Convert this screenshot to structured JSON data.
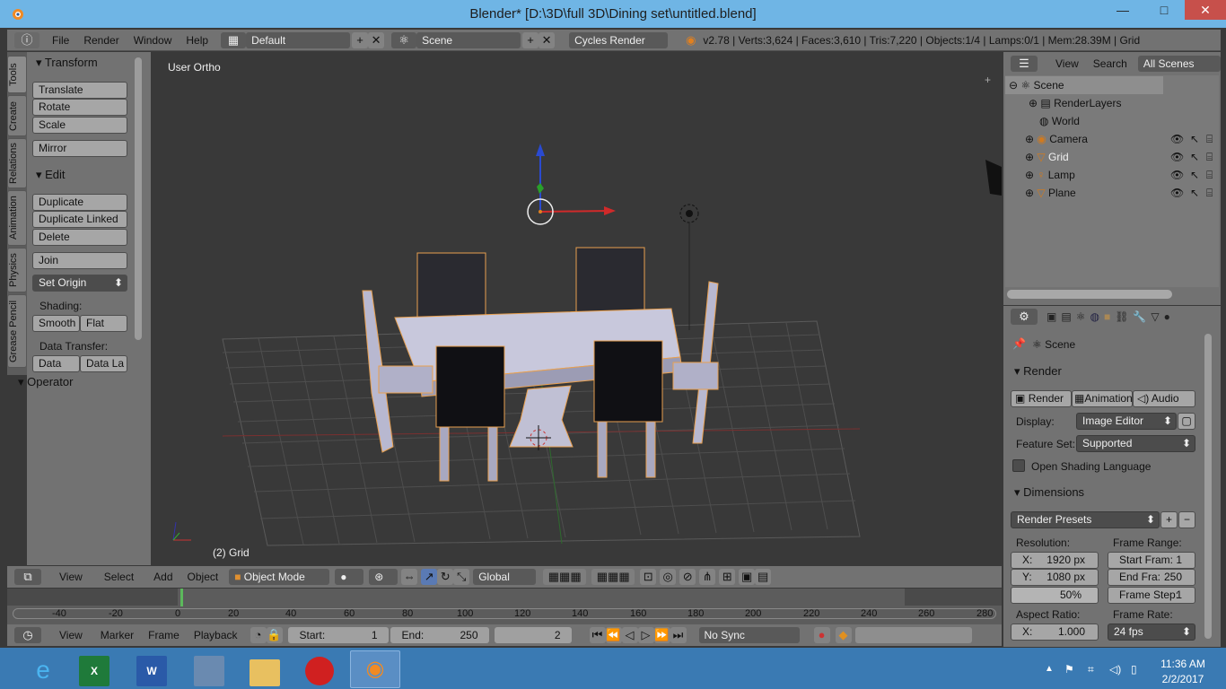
{
  "window": {
    "title": "Blender* [D:\\3D\\full 3D\\Dining set\\untitled.blend]",
    "minimize": "—",
    "maximize": "□",
    "close": "✕"
  },
  "info_header": {
    "menus": [
      "File",
      "Render",
      "Window",
      "Help"
    ],
    "layout": "Default",
    "scene": "Scene",
    "engine": "Cycles Render",
    "stats": "v2.78 | Verts:3,624 | Faces:3,610 | Tris:7,220 | Objects:1/4 | Lamps:0/1 | Mem:28.39M | Grid"
  },
  "tool_tabs": [
    "Tools",
    "Create",
    "Relations",
    "Animation",
    "Physics",
    "Grease Pencil"
  ],
  "tools": {
    "transform_header": "Transform",
    "translate": "Translate",
    "rotate": "Rotate",
    "scale": "Scale",
    "mirror": "Mirror",
    "edit_header": "Edit",
    "duplicate": "Duplicate",
    "duplicate_linked": "Duplicate Linked",
    "delete": "Delete",
    "join": "Join",
    "set_origin": "Set Origin",
    "shading_label": "Shading:",
    "smooth": "Smooth",
    "flat": "Flat",
    "data_transfer_label": "Data Transfer:",
    "data": "Data",
    "data_layout": "Data La",
    "operator_header": "Operator"
  },
  "viewport": {
    "view_name": "User Ortho",
    "selected_label": "(2) Grid"
  },
  "outliner": {
    "menus": [
      "View",
      "Search"
    ],
    "filter": "All Scenes",
    "items": [
      {
        "label": "Scene",
        "icon": "scene-icon"
      },
      {
        "label": "RenderLayers",
        "icon": "renderlayers-icon"
      },
      {
        "label": "World",
        "icon": "world-icon"
      },
      {
        "label": "Camera",
        "icon": "camera-icon"
      },
      {
        "label": "Grid",
        "icon": "mesh-icon"
      },
      {
        "label": "Lamp",
        "icon": "lamp-icon"
      },
      {
        "label": "Plane",
        "icon": "mesh-icon"
      }
    ]
  },
  "properties": {
    "context": "Scene",
    "render_header": "Render",
    "render_btn": "Render",
    "animation_btn": "Animation",
    "audio_btn": "Audio",
    "display_label": "Display:",
    "display_value": "Image Editor",
    "feature_label": "Feature Set:",
    "feature_value": "Supported",
    "osl_label": "Open Shading Language",
    "dimensions_header": "Dimensions",
    "presets": "Render Presets",
    "resolution_label": "Resolution:",
    "res_x": "X:",
    "res_x_val": "1920 px",
    "res_y": "Y:",
    "res_y_val": "1080 px",
    "res_pct": "50%",
    "frame_range_label": "Frame Range:",
    "start_frame": "Start Fram:",
    "start_frame_val": "1",
    "end_frame": "End Fra:",
    "end_frame_val": "250",
    "frame_step": "Frame Step:",
    "frame_step_val": "1",
    "aspect_label": "Aspect Ratio:",
    "aspect_x": "X:",
    "aspect_x_val": "1.000",
    "frame_rate_label": "Frame Rate:",
    "frame_rate": "24 fps"
  },
  "view3d_header": {
    "menus": [
      "View",
      "Select",
      "Add",
      "Object"
    ],
    "mode": "Object Mode",
    "orientation": "Global"
  },
  "timeline": {
    "ticks": [
      "-40",
      "-20",
      "0",
      "20",
      "40",
      "60",
      "80",
      "100",
      "120",
      "140",
      "160",
      "180",
      "200",
      "220",
      "240",
      "260",
      "280"
    ],
    "menus": [
      "View",
      "Marker",
      "Frame",
      "Playback"
    ],
    "start_label": "Start:",
    "start_val": "1",
    "end_label": "End:",
    "end_val": "250",
    "current": "2",
    "sync": "No Sync"
  },
  "taskbar": {
    "time": "11:36 AM",
    "date": "2/2/2017"
  }
}
